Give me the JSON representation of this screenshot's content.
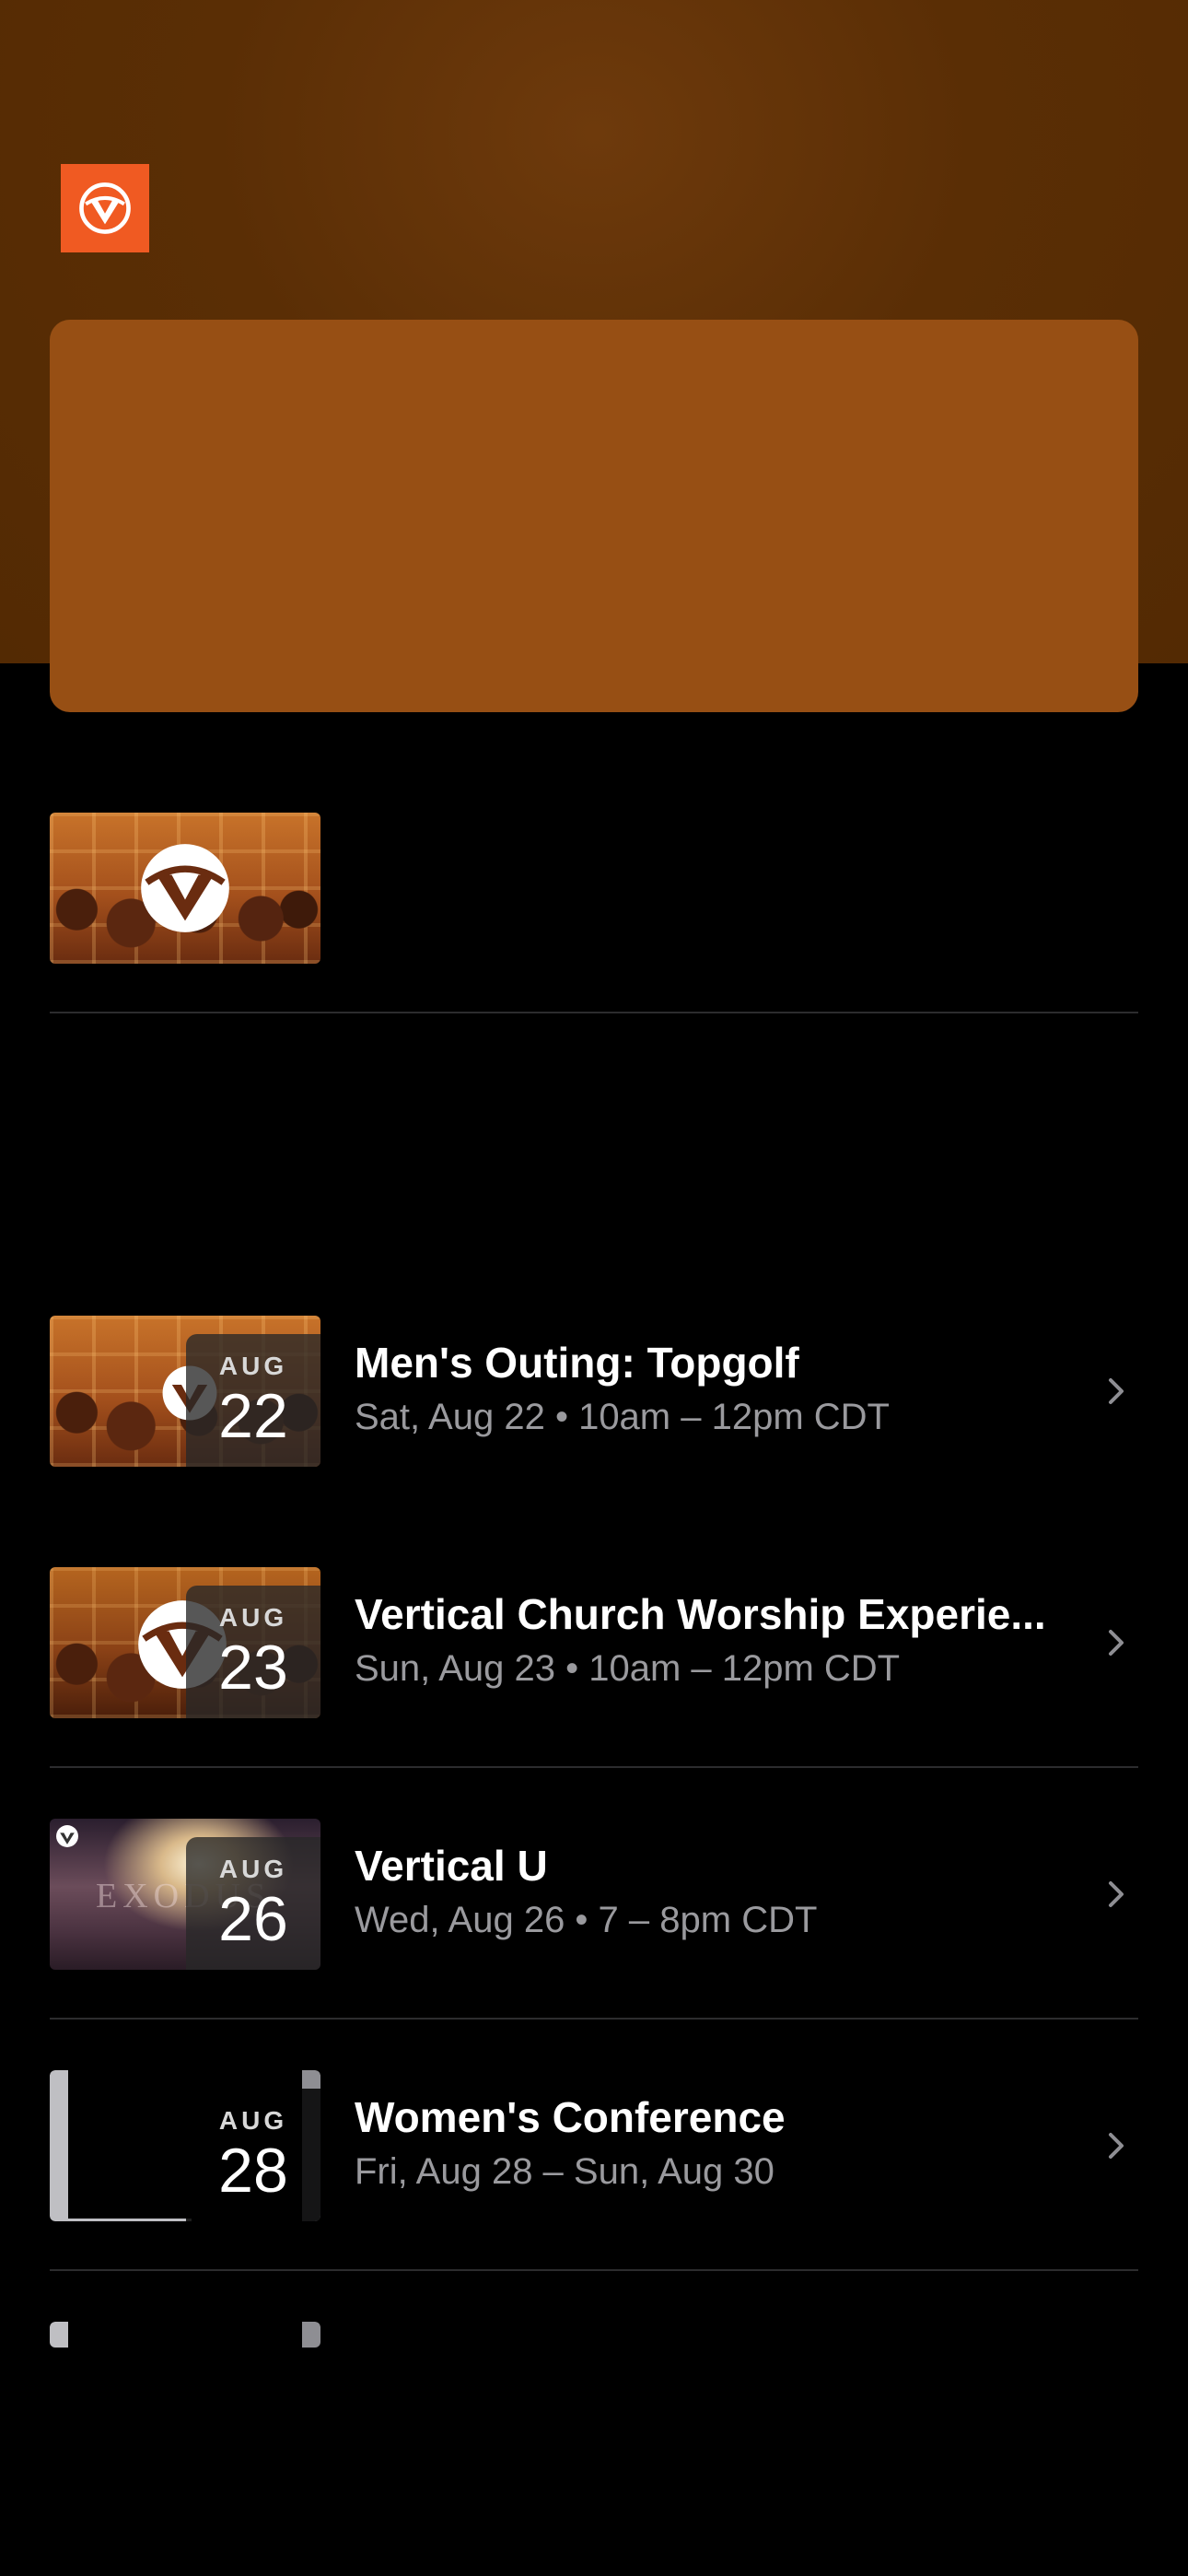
{
  "header": {
    "logo_icon": "vertical-church-logo",
    "accent_color": "#f05a22",
    "featured_card_color": "#974f14"
  },
  "featured_event": {
    "thumb_icon": "vertical-church-logo"
  },
  "events": [
    {
      "month": "AUG",
      "day": "22",
      "title": "Men's Outing: Topgolf",
      "subtitle": "Sat, Aug 22 • 10am – 12pm CDT"
    },
    {
      "month": "AUG",
      "day": "23",
      "title": "Vertical Church Worship Experie...",
      "subtitle": "Sun, Aug 23 • 10am – 12pm CDT"
    },
    {
      "month": "AUG",
      "day": "26",
      "title": "Vertical U",
      "subtitle": "Wed, Aug 26 • 7 – 8pm CDT",
      "thumb_text": "EXODUS"
    },
    {
      "month": "AUG",
      "day": "28",
      "title": "Women's Conference",
      "subtitle": "Fri, Aug 28 – Sun, Aug 30"
    }
  ]
}
